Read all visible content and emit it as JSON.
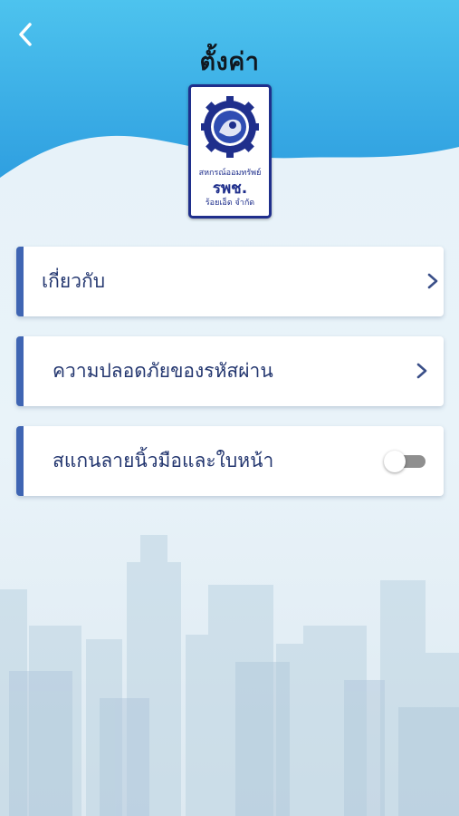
{
  "header": {
    "title": "ตั้งค่า",
    "back_icon": "chevron-left-icon"
  },
  "logo": {
    "line1": "สหกรณ์ออมทรัพย์",
    "line2": "รพช.",
    "line3": "ร้อยเอ็ด จำกัด"
  },
  "menu": {
    "items": [
      {
        "label": "เกี่ยวกับ",
        "control": "chevron-right-icon"
      },
      {
        "label": "ความปลอดภัยของรหัสผ่าน",
        "control": "chevron-right-icon"
      },
      {
        "label": "สแกนลายนิ้วมือและใบหน้า",
        "control": "toggle",
        "enabled": false
      }
    ]
  },
  "colors": {
    "header_top": "#4dc3ee",
    "header_bottom": "#2f9fe0",
    "card_accent": "#3f65b3",
    "label_text": "#23366f",
    "toggle_off": "#8f8f8f"
  }
}
